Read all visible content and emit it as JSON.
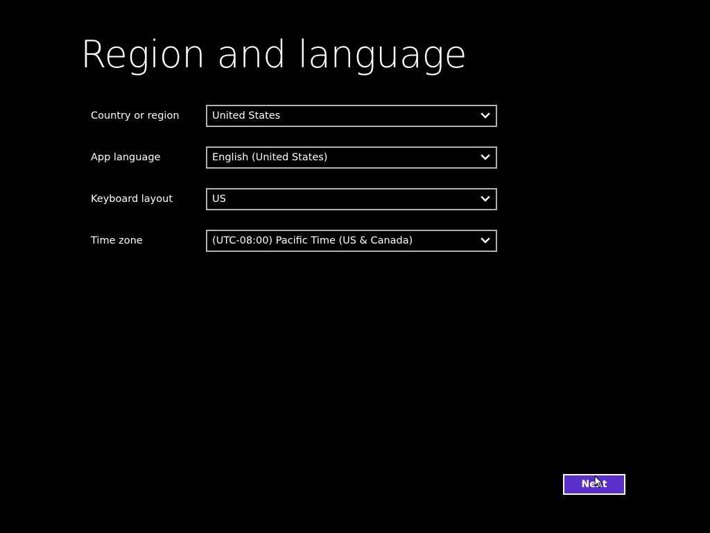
{
  "page": {
    "title": "Region and language",
    "background_color": "#000000",
    "accent_color": "#5b2fc9"
  },
  "form": {
    "fields": [
      {
        "label": "Country or region",
        "value": "United States",
        "icon": "chevron-down-icon"
      },
      {
        "label": "App language",
        "value": "English (United States)",
        "icon": "chevron-down-icon"
      },
      {
        "label": "Keyboard layout",
        "value": "US",
        "icon": "chevron-down-icon"
      },
      {
        "label": "Time zone",
        "value": "(UTC-08:00) Pacific Time (US & Canada)",
        "icon": "chevron-down-icon"
      }
    ]
  },
  "footer": {
    "next_label": "Next"
  },
  "cursor": {
    "icon": "mouse-pointer-icon"
  }
}
